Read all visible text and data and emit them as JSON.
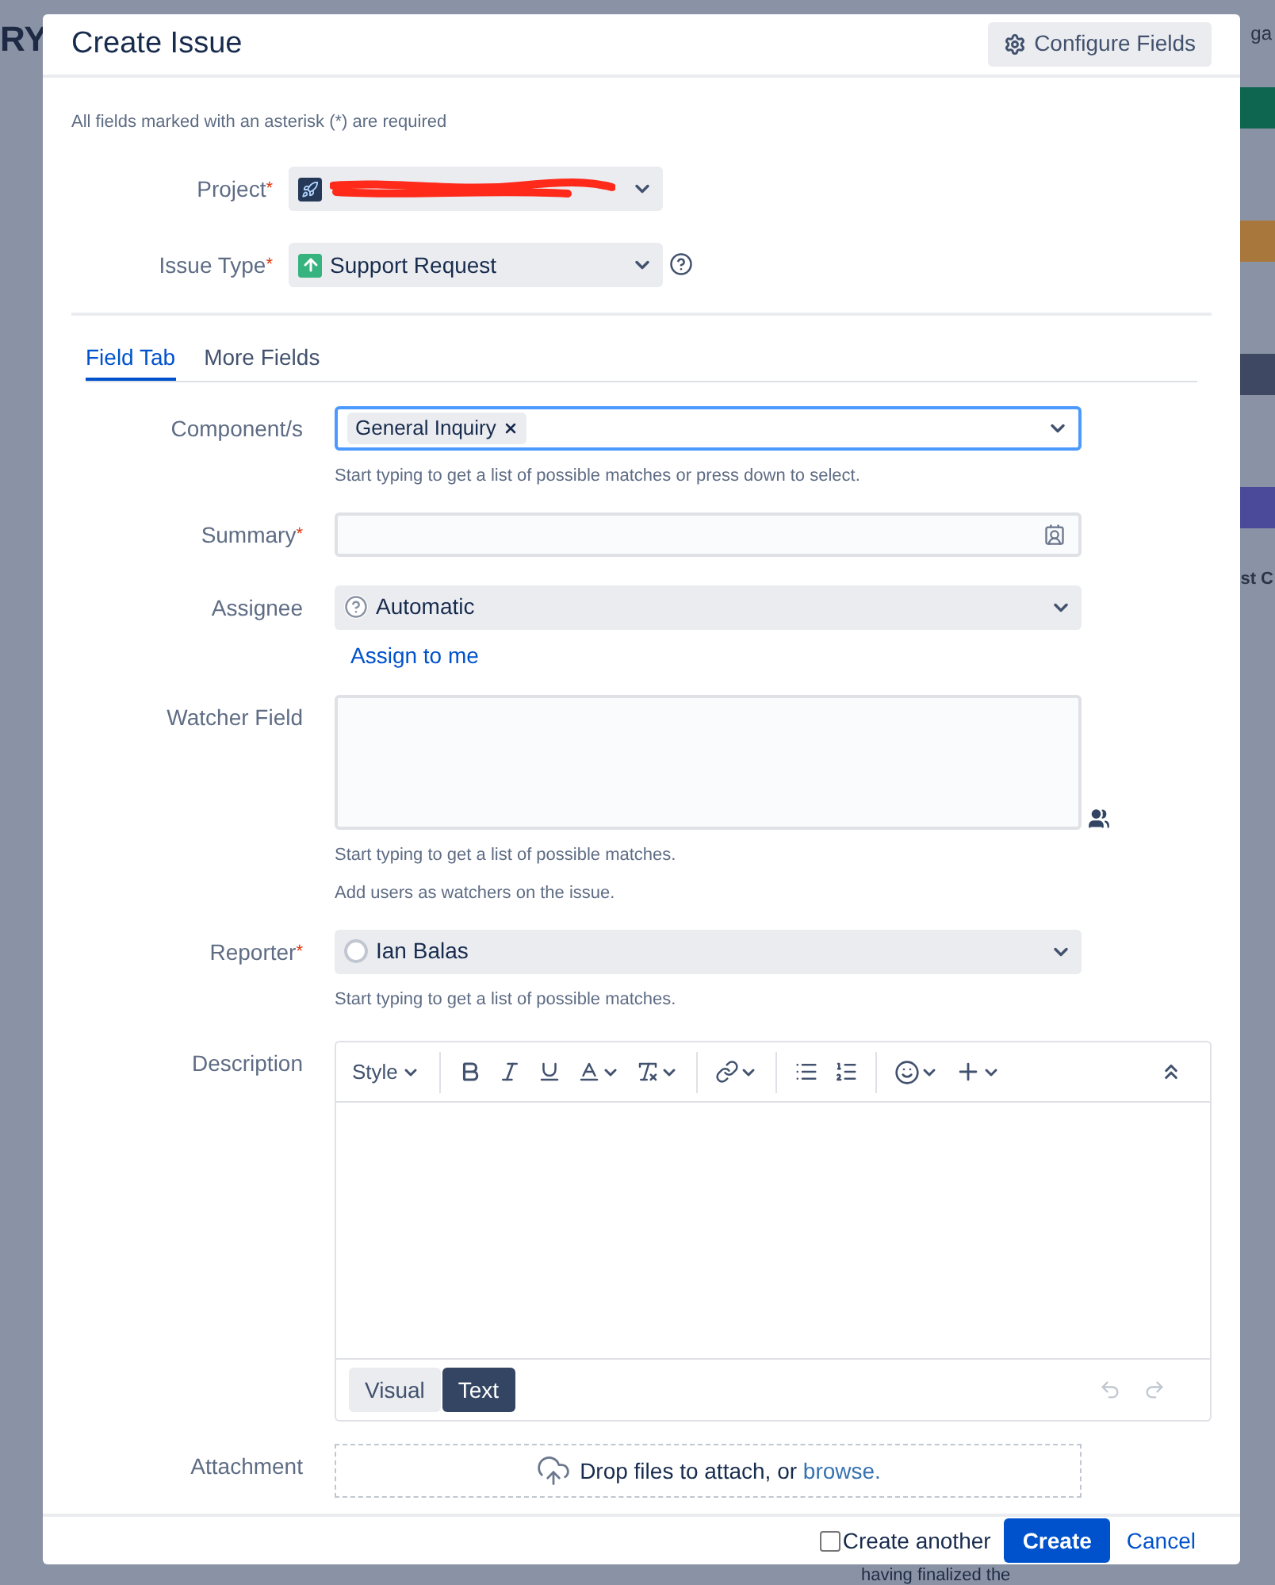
{
  "background": {
    "texts": [
      "RY",
      "ga",
      "st C",
      "having finalized the"
    ]
  },
  "dialog": {
    "title": "Create Issue",
    "configure_button": "Configure Fields",
    "required_note": "All fields marked with an asterisk (*) are required",
    "top_fields": [
      {
        "kind": "project",
        "label": "Project",
        "asterisk": "*"
      },
      {
        "kind": "issue_type",
        "label": "Issue Type",
        "asterisk": "*",
        "value": "Support Request"
      }
    ],
    "tabs": [
      {
        "label": "Field Tab",
        "selected": true
      },
      {
        "label": "More Fields",
        "selected": false
      }
    ],
    "fields": [
      {
        "kind": "tags",
        "label": "Component/s",
        "tags": [
          "General Inquiry"
        ],
        "hints": [
          "Start typing to get a list of possible matches or press down to select."
        ]
      },
      {
        "kind": "text",
        "label": "Summary",
        "asterisk": "*"
      },
      {
        "kind": "assignee",
        "label": "Assignee",
        "value": "Automatic",
        "link": "Assign to me"
      },
      {
        "kind": "textarea",
        "label": "Watcher Field",
        "hints": [
          "Start typing to get a list of possible matches.",
          "Add users as watchers on the issue."
        ]
      },
      {
        "kind": "reporter",
        "label": "Reporter",
        "asterisk": "*",
        "value": "Ian Balas",
        "hints": [
          "Start typing to get a list of possible matches."
        ]
      },
      {
        "kind": "editor",
        "label": "Description",
        "style_button": "Style",
        "modes": [
          {
            "label": "Visual",
            "selected": false
          },
          {
            "label": "Text",
            "selected": true
          }
        ]
      },
      {
        "kind": "attachment",
        "label": "Attachment",
        "text": "Drop files to attach, or ",
        "link": "browse."
      }
    ],
    "footer": {
      "create_another": {
        "label": "Create another",
        "checked": false
      },
      "create": "Create",
      "cancel": "Cancel"
    }
  }
}
